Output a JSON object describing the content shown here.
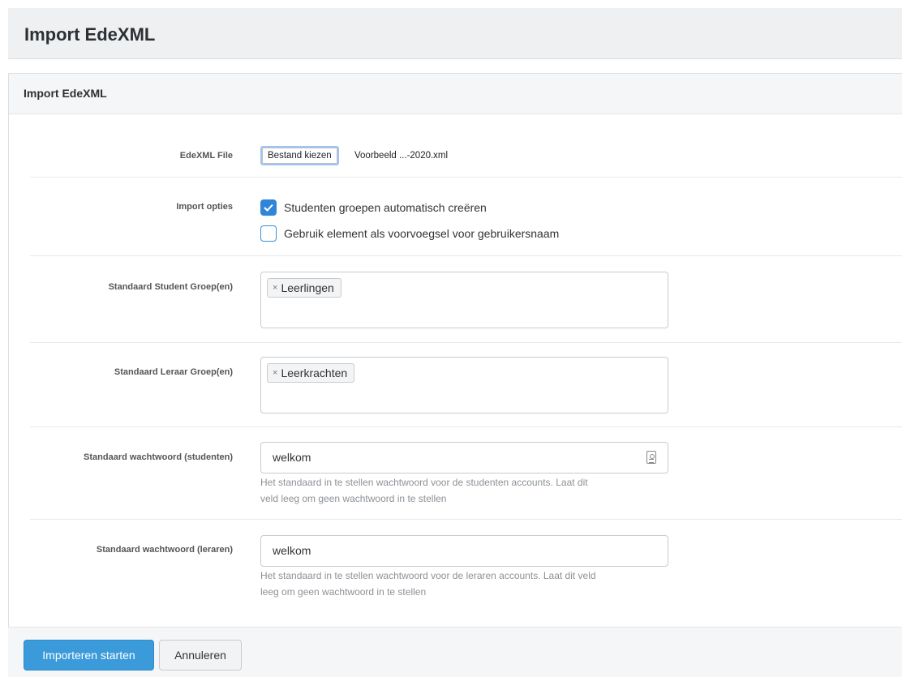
{
  "page": {
    "title": "Import EdeXML"
  },
  "panel": {
    "heading": "Import EdeXML"
  },
  "file": {
    "label": "EdeXML File",
    "button_label": "Bestand kiezen",
    "filename": "Voorbeeld ...-2020.xml"
  },
  "import_options": {
    "label": "Import opties",
    "options": [
      {
        "label": "Studenten groepen automatisch creëren",
        "checked": true
      },
      {
        "label": "Gebruik element als voorvoegsel voor gebruikersnaam",
        "checked": false
      }
    ]
  },
  "student_groups": {
    "label": "Standaard Student Groep(en)",
    "tags": [
      "Leerlingen"
    ]
  },
  "teacher_groups": {
    "label": "Standaard Leraar Groep(en)",
    "tags": [
      "Leerkrachten"
    ]
  },
  "student_password": {
    "label": "Standaard wachtwoord (studenten)",
    "value": "welkom",
    "help_line1": "Het standaard in te stellen wachtwoord voor de studenten accounts. Laat dit",
    "help_line2": "veld leeg om geen wachtwoord in te stellen"
  },
  "teacher_password": {
    "label": "Standaard wachtwoord (leraren)",
    "value": "welkom",
    "help_line1": "Het standaard in te stellen wachtwoord voor de leraren accounts. Laat dit veld",
    "help_line2": "leeg om geen wachtwoord in te stellen"
  },
  "footer": {
    "submit_label": "Importeren starten",
    "cancel_label": "Annuleren"
  },
  "colors": {
    "primary": "#3b9ad9",
    "checkbox_checked": "#2f86d8"
  }
}
